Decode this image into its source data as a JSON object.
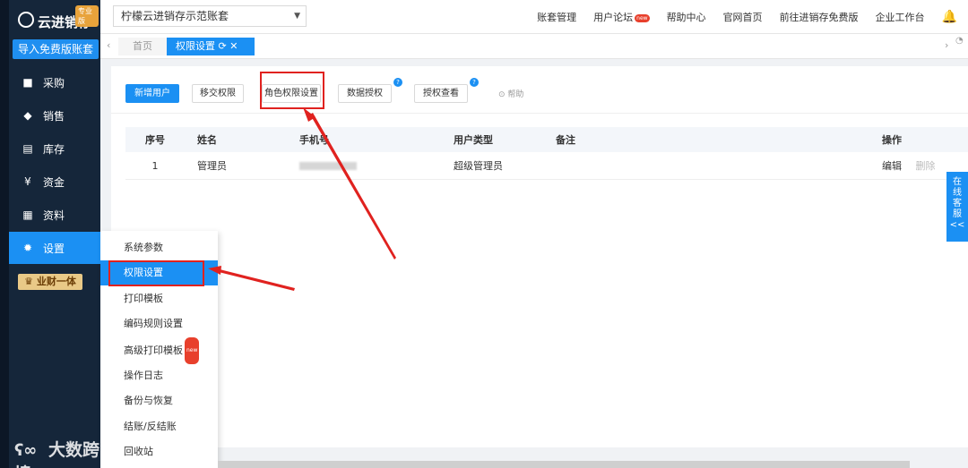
{
  "sidebar": {
    "logo_text": "云进销存",
    "pro_badge": "专业版",
    "import_button": "导入免费版账套",
    "nav": [
      {
        "label": "采购",
        "icon": "bag-icon"
      },
      {
        "label": "销售",
        "icon": "tag-icon"
      },
      {
        "label": "库存",
        "icon": "warehouse-icon"
      },
      {
        "label": "资金",
        "icon": "yen-icon"
      },
      {
        "label": "资料",
        "icon": "document-icon"
      },
      {
        "label": "设置",
        "icon": "gear-icon"
      }
    ],
    "vip_label": "业财一体"
  },
  "topbar": {
    "account": "柠檬云进销存示范账套",
    "links": [
      "账套管理",
      "用户论坛",
      "帮助中心",
      "官网首页",
      "前往进销存免费版",
      "企业工作台"
    ],
    "new_badge": "new"
  },
  "tabs": {
    "home": "首页",
    "active": "权限设置"
  },
  "toolbar": {
    "add_user": "新增用户",
    "transfer": "移交权限",
    "role": "角色权限设置",
    "data_auth": "数据授权",
    "view_auth": "授权查看",
    "help": "帮助",
    "question": "?"
  },
  "table": {
    "headers": [
      "序号",
      "姓名",
      "手机号",
      "用户类型",
      "备注",
      "操作"
    ],
    "rows": [
      {
        "seq": "1",
        "name": "管理员",
        "type": "超级管理员",
        "note": "",
        "edit": "编辑",
        "del": "删除"
      }
    ]
  },
  "menu": {
    "items": [
      "系统参数",
      "权限设置",
      "打印模板",
      "编码规则设置",
      "高级打印模板",
      "操作日志",
      "备份与恢复",
      "结账/反结账",
      "回收站"
    ],
    "new_badge": "new"
  },
  "service": {
    "label": "在线客服",
    "chevrons": "<<"
  },
  "watermark": "大数跨境",
  "colors": {
    "accent": "#1b90f3",
    "sidebar": "#15263a",
    "highlight": "#e0221f"
  }
}
